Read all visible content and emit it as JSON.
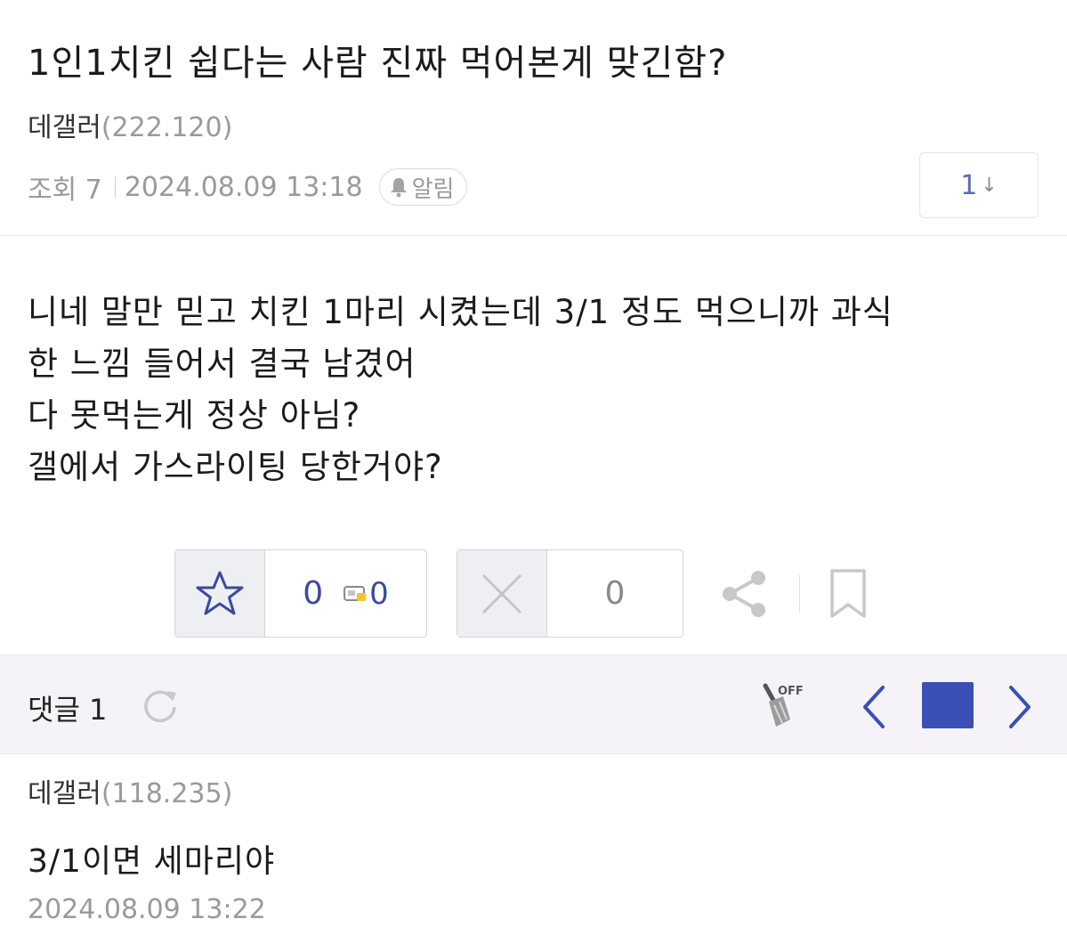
{
  "post": {
    "title": "1인1치킨 쉽다는 사람 진짜 먹어본게 맞긴함?",
    "author_name": "데갤러",
    "author_ip": "(222.120)",
    "views_label": "조회 7",
    "date": "2024.08.09 13:18",
    "alarm_label": "알림",
    "reply_jump_count": "1",
    "reply_jump_arrow": "↓",
    "body_lines": [
      "니네 말만 믿고 치킨 1마리 시켰는데 3/1 정도 먹으니까 과식",
      "한 느낌 들어서 결국 남겼어",
      "다 못먹는게 정상 아님?",
      "갤에서 가스라이팅 당한거야?"
    ]
  },
  "actions": {
    "recommend_count": "0",
    "fix_count": "0",
    "nonrecommend_count": "0",
    "star_icon": "star-outline-icon",
    "x_icon": "x-icon",
    "share_icon": "share-icon",
    "bookmark_icon": "bookmark-icon"
  },
  "comments_bar": {
    "label": "댓글 1",
    "broom_off_label": "OFF"
  },
  "comments": [
    {
      "author_name": "데갤러",
      "author_ip": "(118.235)",
      "text": "3/1이면 세마리야",
      "date": "2024.08.09 13:22"
    }
  ],
  "colors": {
    "accent": "#3a50b6",
    "text": "#1b1b1b",
    "muted": "#9a9a9a",
    "bar_bg": "#f5f3f7"
  }
}
